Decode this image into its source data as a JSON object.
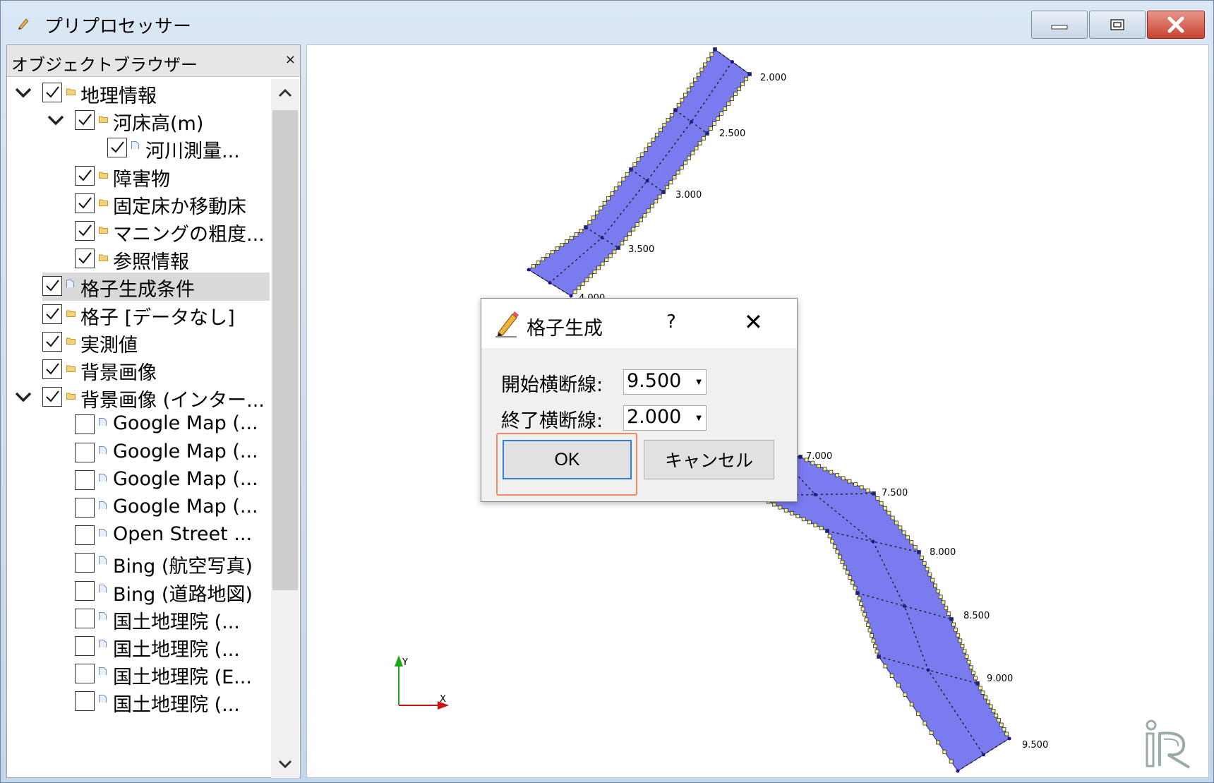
{
  "window": {
    "title": "プリプロセッサー",
    "minimize_icon": "minimize-icon",
    "maximize_icon": "restore-icon",
    "close_icon": "close-icon"
  },
  "browser": {
    "title": "オブジェクトブラウザー",
    "close_label": "×",
    "items": [
      {
        "label": "地理情報",
        "checked": true,
        "icon": "folder-icon",
        "expanded": true
      },
      {
        "label": "河床高(m)",
        "checked": true,
        "icon": "folder-icon",
        "expanded": true
      },
      {
        "label": "河川測量...",
        "checked": true,
        "icon": "file-icon"
      },
      {
        "label": "障害物",
        "checked": true,
        "icon": "folder-icon"
      },
      {
        "label": "固定床か移動床",
        "checked": true,
        "icon": "folder-icon"
      },
      {
        "label": "マニングの粗度...",
        "checked": true,
        "icon": "folder-icon"
      },
      {
        "label": "参照情報",
        "checked": true,
        "icon": "folder-icon"
      },
      {
        "label": "格子生成条件",
        "checked": true,
        "icon": "file-icon",
        "selected": true
      },
      {
        "label": "格子 [データなし]",
        "checked": true,
        "icon": "folder-icon"
      },
      {
        "label": "実測値",
        "checked": true,
        "icon": "folder-icon"
      },
      {
        "label": "背景画像",
        "checked": true,
        "icon": "folder-icon"
      },
      {
        "label": "背景画像 (インター...",
        "checked": true,
        "icon": "folder-icon",
        "expanded": true
      },
      {
        "label": "Google Map (...",
        "checked": false,
        "icon": "file-icon"
      },
      {
        "label": "Google Map (...",
        "checked": false,
        "icon": "file-icon"
      },
      {
        "label": "Google Map (...",
        "checked": false,
        "icon": "file-icon"
      },
      {
        "label": "Google Map (...",
        "checked": false,
        "icon": "file-icon"
      },
      {
        "label": "Open Street ...",
        "checked": false,
        "icon": "file-icon"
      },
      {
        "label": "Bing (航空写真)",
        "checked": false,
        "icon": "file-icon"
      },
      {
        "label": "Bing (道路地図)",
        "checked": false,
        "icon": "file-icon"
      },
      {
        "label": "国土地理院 (...",
        "checked": false,
        "icon": "file-icon"
      },
      {
        "label": "国土地理院 (...",
        "checked": false,
        "icon": "file-icon"
      },
      {
        "label": "国土地理院 (E...",
        "checked": false,
        "icon": "file-icon"
      },
      {
        "label": "国土地理院 (...",
        "checked": false,
        "icon": "file-icon"
      }
    ]
  },
  "canvas": {
    "mesh_color": "#7b7bf0",
    "cross_sections": [
      "2.000",
      "2.500",
      "3.000",
      "3.500",
      "4.000",
      "7.000",
      "7.500",
      "8.000",
      "8.500",
      "9.000",
      "9.500"
    ],
    "axis_y_label": "Y",
    "axis_x_label": "X",
    "logo_icon": "iric-logo-icon"
  },
  "dialog": {
    "title": "格子生成",
    "help_label": "?",
    "close_label": "✕",
    "start_label": "開始横断線:",
    "start_value": "9.500",
    "end_label": "終了横断線:",
    "end_value": "2.000",
    "ok_label": "OK",
    "cancel_label": "キャンセル",
    "highlight_color": "#ef8a62"
  }
}
